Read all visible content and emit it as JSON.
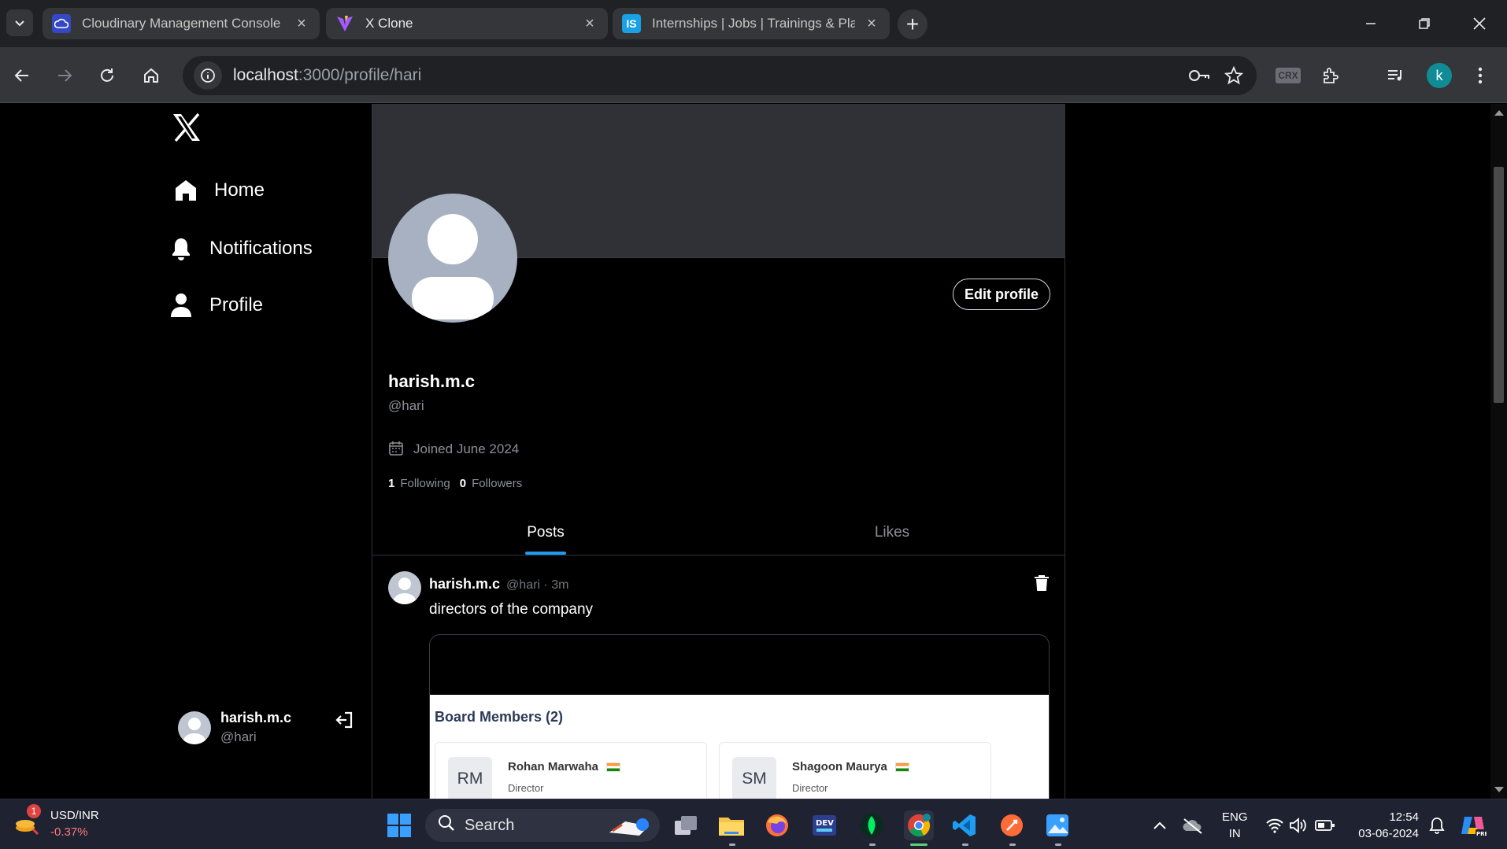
{
  "browser": {
    "tabs": [
      {
        "title": "Cloudinary Management Console",
        "active": false
      },
      {
        "title": "X Clone",
        "active": true
      },
      {
        "title": "Internships | Jobs | Trainings & Pla",
        "active": false
      }
    ],
    "url_host": "localhost",
    "url_path": ":3000/profile/hari",
    "profile_initial": "k",
    "crx_label": "CRX"
  },
  "sidebar": {
    "items": [
      {
        "label": "Home"
      },
      {
        "label": "Notifications"
      },
      {
        "label": "Profile"
      }
    ],
    "user": {
      "name": "harish.m.c",
      "handle": "@hari"
    }
  },
  "profile": {
    "edit_label": "Edit profile",
    "name": "harish.m.c",
    "handle": "@hari",
    "joined": "Joined June 2024",
    "following_count": "1",
    "following_label": "Following",
    "followers_count": "0",
    "followers_label": "Followers",
    "tabs": [
      {
        "label": "Posts",
        "active": true
      },
      {
        "label": "Likes",
        "active": false
      }
    ]
  },
  "post": {
    "name": "harish.m.c",
    "meta": "@hari · 3m",
    "text": "directors of the company",
    "image": {
      "title": "Board Members (2)",
      "members": [
        {
          "initials": "RM",
          "name": "Rohan Marwaha",
          "role": "Director"
        },
        {
          "initials": "SM",
          "name": "Shagoon Maurya",
          "role": "Director"
        }
      ]
    }
  },
  "taskbar": {
    "widget_label": "USD/INR",
    "widget_change": "-0.37%",
    "widget_badge": "1",
    "search_label": "Search",
    "lang_top": "ENG",
    "lang_bottom": "IN",
    "time": "12:54",
    "date": "03-06-2024"
  },
  "colors": {
    "accent": "#1d9bf0",
    "cover": "#2f3136",
    "avatar_bg": "#a7b1c1"
  }
}
